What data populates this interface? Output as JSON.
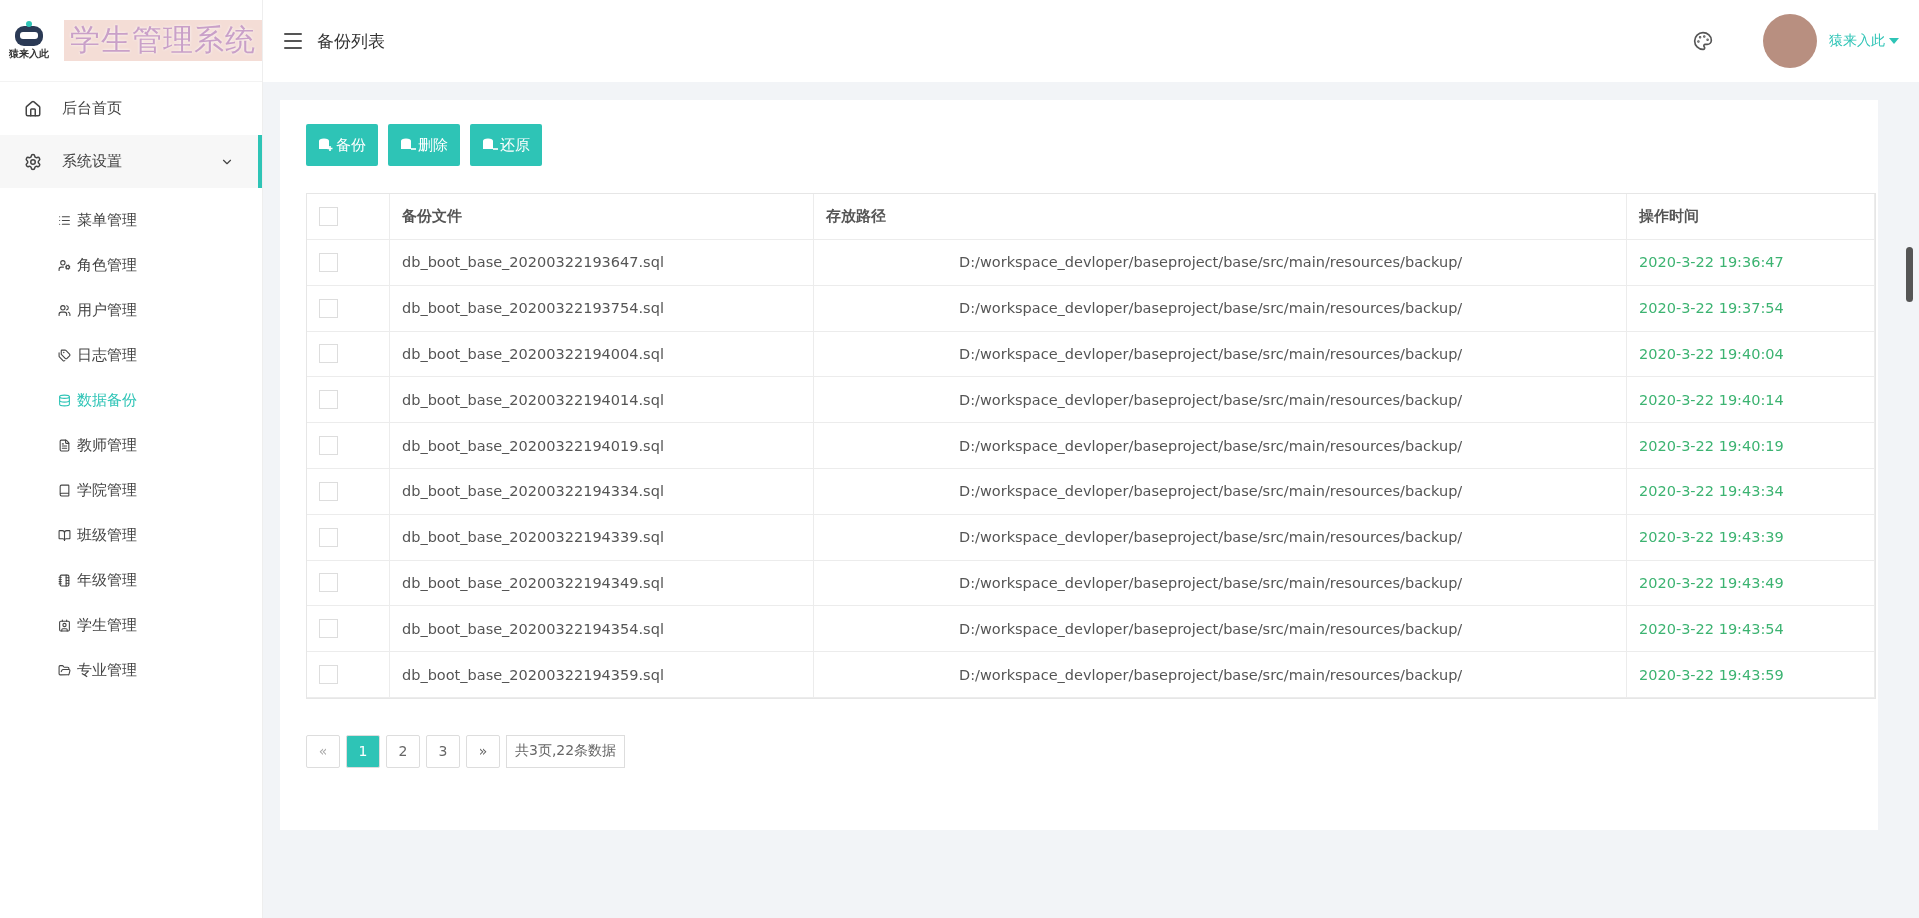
{
  "logo": {
    "caption": "猿来入此",
    "title": "学生管理系统"
  },
  "header": {
    "title": "备份列表",
    "user": "猿来入此"
  },
  "sidebar": {
    "items": [
      {
        "label": "后台首页",
        "kind": "home",
        "selected": false,
        "expanded": false
      },
      {
        "label": "系统设置",
        "kind": "settings",
        "selected": false,
        "expanded": true,
        "children": [
          {
            "label": "菜单管理",
            "kind": "list",
            "selected": false
          },
          {
            "label": "角色管理",
            "kind": "user-cog",
            "selected": false
          },
          {
            "label": "用户管理",
            "kind": "users",
            "selected": false
          },
          {
            "label": "日志管理",
            "kind": "tags",
            "selected": false
          },
          {
            "label": "数据备份",
            "kind": "database",
            "selected": true
          },
          {
            "label": "教师管理",
            "kind": "file",
            "selected": false
          },
          {
            "label": "学院管理",
            "kind": "book",
            "selected": false
          },
          {
            "label": "班级管理",
            "kind": "book-open",
            "selected": false
          },
          {
            "label": "年级管理",
            "kind": "notebook",
            "selected": false
          },
          {
            "label": "学生管理",
            "kind": "contact",
            "selected": false
          },
          {
            "label": "专业管理",
            "kind": "folder",
            "selected": false
          }
        ]
      }
    ]
  },
  "toolbar": [
    {
      "label": "备份",
      "kind": "plus"
    },
    {
      "label": "删除",
      "kind": "minus"
    },
    {
      "label": "还原",
      "kind": "minus"
    }
  ],
  "table": {
    "all_checked": false,
    "columns": [
      "备份文件",
      "存放路径",
      "操作时间"
    ],
    "rows": [
      {
        "checked": false,
        "file": "db_boot_base_20200322193647.sql",
        "path": "D:/workspace_devloper/baseproject/base/src/main/resources/backup/",
        "time": "2020-3-22 19:36:47"
      },
      {
        "checked": false,
        "file": "db_boot_base_20200322193754.sql",
        "path": "D:/workspace_devloper/baseproject/base/src/main/resources/backup/",
        "time": "2020-3-22 19:37:54"
      },
      {
        "checked": false,
        "file": "db_boot_base_20200322194004.sql",
        "path": "D:/workspace_devloper/baseproject/base/src/main/resources/backup/",
        "time": "2020-3-22 19:40:04"
      },
      {
        "checked": false,
        "file": "db_boot_base_20200322194014.sql",
        "path": "D:/workspace_devloper/baseproject/base/src/main/resources/backup/",
        "time": "2020-3-22 19:40:14"
      },
      {
        "checked": false,
        "file": "db_boot_base_20200322194019.sql",
        "path": "D:/workspace_devloper/baseproject/base/src/main/resources/backup/",
        "time": "2020-3-22 19:40:19"
      },
      {
        "checked": false,
        "file": "db_boot_base_20200322194334.sql",
        "path": "D:/workspace_devloper/baseproject/base/src/main/resources/backup/",
        "time": "2020-3-22 19:43:34"
      },
      {
        "checked": false,
        "file": "db_boot_base_20200322194339.sql",
        "path": "D:/workspace_devloper/baseproject/base/src/main/resources/backup/",
        "time": "2020-3-22 19:43:39"
      },
      {
        "checked": false,
        "file": "db_boot_base_20200322194349.sql",
        "path": "D:/workspace_devloper/baseproject/base/src/main/resources/backup/",
        "time": "2020-3-22 19:43:49"
      },
      {
        "checked": false,
        "file": "db_boot_base_20200322194354.sql",
        "path": "D:/workspace_devloper/baseproject/base/src/main/resources/backup/",
        "time": "2020-3-22 19:43:54"
      },
      {
        "checked": false,
        "file": "db_boot_base_20200322194359.sql",
        "path": "D:/workspace_devloper/baseproject/base/src/main/resources/backup/",
        "time": "2020-3-22 19:43:59"
      }
    ]
  },
  "pagination": {
    "prev": "«",
    "next": "»",
    "pages": [
      {
        "label": "1",
        "selected": true
      },
      {
        "label": "2",
        "selected": false
      },
      {
        "label": "3",
        "selected": false
      }
    ],
    "summary": "共3页,22条数据"
  }
}
